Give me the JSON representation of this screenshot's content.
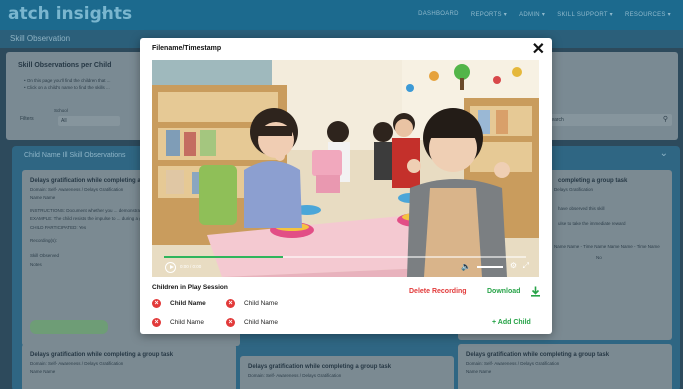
{
  "topbar": {
    "logo": "atch insights",
    "nav": [
      "DASHBOARD",
      "REPORTS ▾",
      "ADMIN ▾",
      "SKILL SUPPORT ▾",
      "RESOURCES ▾"
    ]
  },
  "subbar": {
    "title": "Skill Observation"
  },
  "page": {
    "header": "Skill Observations per Child",
    "bullet1": "• On this page you'll find the children that ...",
    "bullet2": "• Click on a child's name to find the skills ...",
    "filters_label": "Filters",
    "school_label": "School",
    "school_value": "All",
    "search_placeholder": "Search",
    "panel_title": "Child Name Ill Skill Observations",
    "card_title_full": "Delays gratification while completing a group task",
    "card_title_partial": "completing a group task",
    "card_domain": "Domain: Self- Awareness / Delays Gratification",
    "card_domain_partial": "Delays Gratification",
    "card_name": "Name Name",
    "instructions": "INSTRUCTIONS: Document whether you ... demonstrating the skill above",
    "example": "EXAMPLE: The child resists the impulse to ... during a game",
    "child_participated": "CHILD PARTICIPATED: Yes",
    "recordings_label": "Recording(s):",
    "recordings_values": "Name Name - Time Name   Name Name - Time Name",
    "skill_observed": "Skill Observed",
    "yes": "Yes",
    "no": "No",
    "notes": "Notes",
    "right_text1": "have observed this skill",
    "right_text2": "ulse to take the immediate reward",
    "right_recordings": "Name Name - Time Name   Name Name - Time Name"
  },
  "modal": {
    "title": "Filename/Timestamp",
    "video_time": "0:00 / 0:00",
    "progress": 0.33,
    "play_session_title": "Children in Play Session",
    "delete_label": "Delete Recording",
    "download_label": "Download",
    "children": [
      "Child Name",
      "Child Name",
      "Child Name",
      "Child Name"
    ],
    "add_child_label": "+ Add Child"
  },
  "colors": {
    "green": "#27a348",
    "red": "#e23a3a",
    "teal": "#1c6a8e"
  }
}
